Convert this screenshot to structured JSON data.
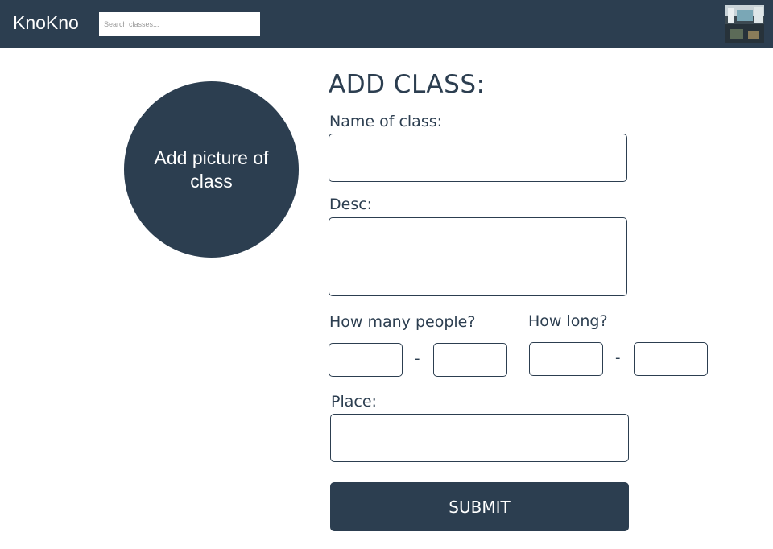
{
  "header": {
    "logo": "KnoKno",
    "search_placeholder": "Search classes...",
    "avatar_icon": "user-photo-icon",
    "background_color": "#2c3e50"
  },
  "photo_upload": {
    "label": "Add picture of class"
  },
  "form": {
    "title": "ADD CLASS:",
    "name_label": "Name of class:",
    "name_value": "",
    "desc_label": "Desc:",
    "desc_value": "",
    "people_label": "How many people?",
    "people_min": "",
    "people_max": "",
    "people_separator": "-",
    "duration_label": "How long?",
    "duration_min": "",
    "duration_max": "",
    "duration_separator": "-",
    "place_label": "Place:",
    "place_value": "",
    "submit_label": "SUBMIT"
  },
  "colors": {
    "primary": "#2c3e50",
    "background": "#ffffff"
  }
}
